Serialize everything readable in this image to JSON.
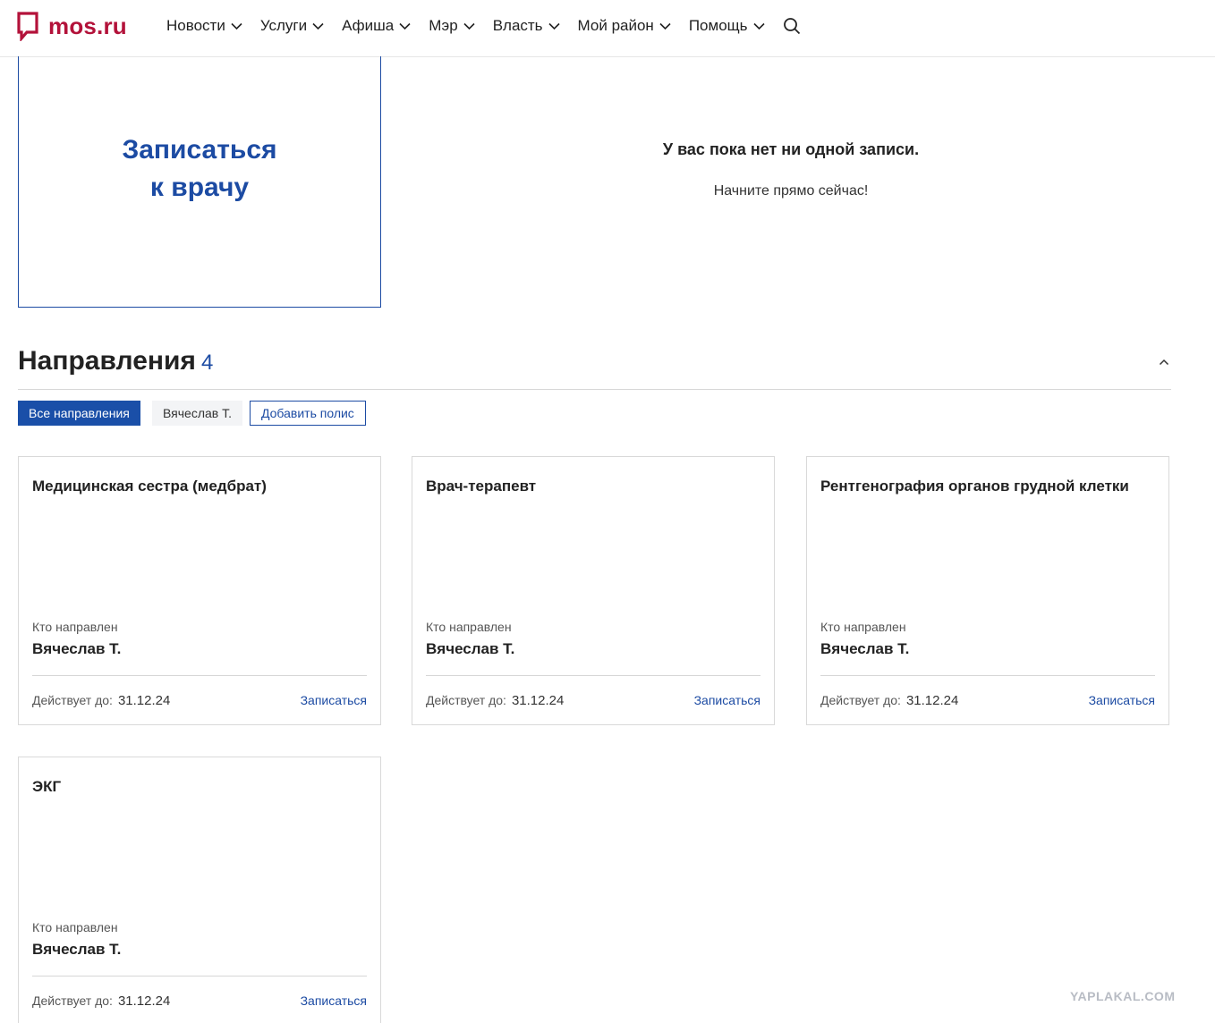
{
  "header": {
    "logo_text": "mos.ru",
    "nav": [
      "Новости",
      "Услуги",
      "Афиша",
      "Мэр",
      "Власть",
      "Мой район",
      "Помощь"
    ]
  },
  "appointment": {
    "card_line1": "Записаться",
    "card_line2": "к врачу",
    "empty_title": "У вас пока нет ни одной записи.",
    "empty_subtitle": "Начните прямо сейчас!"
  },
  "referrals": {
    "title": "Направления",
    "count": "4",
    "filters": {
      "all": "Все направления",
      "person": "Вячеслав Т.",
      "add_policy": "Добавить полис"
    },
    "cards": [
      {
        "title": "Медицинская сестра (медбрат)",
        "who_label": "Кто направлен",
        "who": "Вячеслав Т.",
        "valid_label": "Действует до:",
        "valid": "31.12.24",
        "action": "Записаться"
      },
      {
        "title": "Врач-терапевт",
        "who_label": "Кто направлен",
        "who": "Вячеслав Т.",
        "valid_label": "Действует до:",
        "valid": "31.12.24",
        "action": "Записаться"
      },
      {
        "title": "Рентгенография органов грудной клетки",
        "who_label": "Кто направлен",
        "who": "Вячеслав Т.",
        "valid_label": "Действует до:",
        "valid": "31.12.24",
        "action": "Записаться"
      },
      {
        "title": "ЭКГ",
        "who_label": "Кто направлен",
        "who": "Вячеслав Т.",
        "valid_label": "Действует до:",
        "valid": "31.12.24",
        "action": "Записаться"
      }
    ]
  },
  "watermark": "YAPLAKAL.COM",
  "colors": {
    "brand": "#b3123a",
    "accent": "#1c4ba3"
  },
  "icons": [
    "mos-logo-icon",
    "chevron-down-icon",
    "search-icon",
    "chevron-up-icon"
  ]
}
